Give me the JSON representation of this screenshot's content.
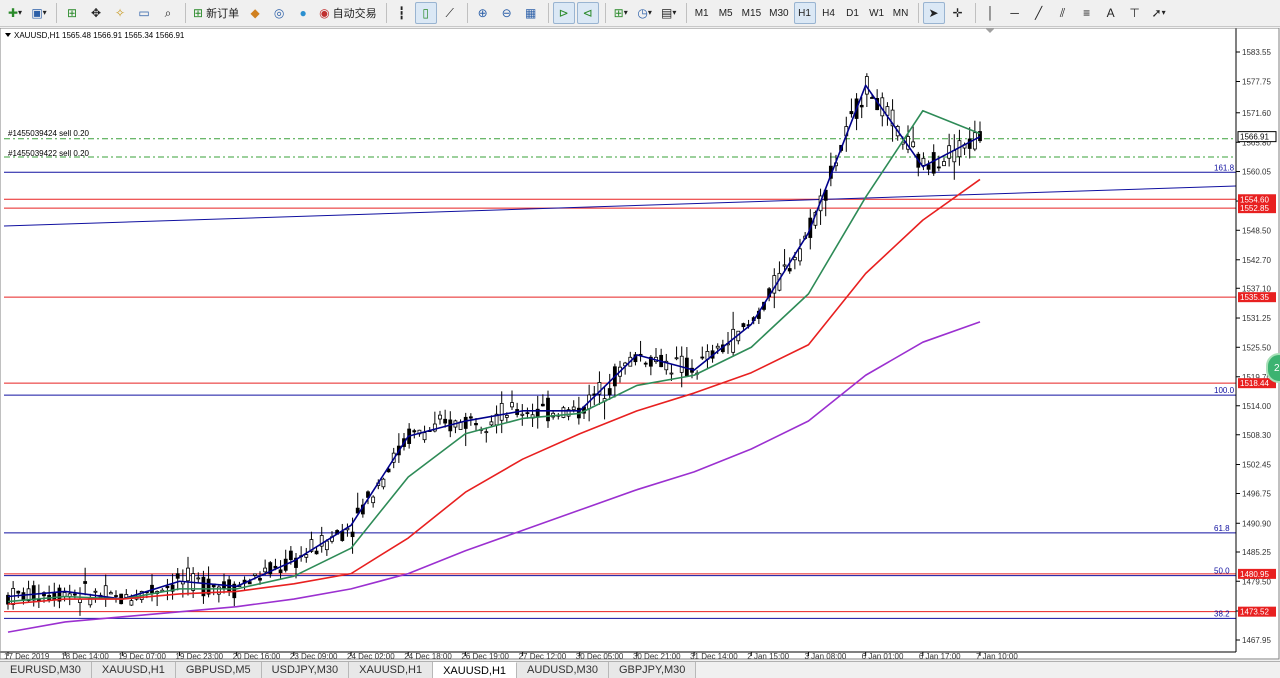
{
  "toolbar": {
    "new_order_label": "新订单",
    "auto_trade_label": "自动交易",
    "timeframes": [
      "M1",
      "M5",
      "M15",
      "M30",
      "H1",
      "H4",
      "D1",
      "W1",
      "MN"
    ],
    "active_timeframe": "H1",
    "text_tool_label": "A"
  },
  "chart": {
    "header": "XAUUSD,H1  1565.48 1566.91 1565.34 1566.91",
    "order_labels": [
      "#1455039424 sell 0.20",
      "#1455039422 sell 0.20"
    ],
    "current_price_tag": "1566.91",
    "price_ticks": [
      "1583.55",
      "1577.75",
      "1571.60",
      "1565.80",
      "1560.05",
      "1554.25",
      "1548.50",
      "1542.70",
      "1537.10",
      "1531.25",
      "1525.50",
      "1519.70",
      "1514.00",
      "1508.30",
      "1502.45",
      "1496.75",
      "1490.90",
      "1485.25",
      "1479.50",
      "1473.65",
      "1467.95"
    ],
    "price_tags": [
      {
        "label": "1554.60",
        "color": "#e82020"
      },
      {
        "label": "1552.85",
        "color": "#e82020"
      },
      {
        "label": "1535.35",
        "color": "#e82020"
      },
      {
        "label": "1518.44",
        "color": "#e82020"
      },
      {
        "label": "1480.95",
        "color": "#e82020"
      },
      {
        "label": "1473.52",
        "color": "#e82020"
      }
    ],
    "fib_labels": [
      "161.8",
      "100.0",
      "61.8",
      "50.0",
      "38.2"
    ],
    "time_labels": [
      "17 Dec 2019",
      "18 Dec 14:00",
      "19 Dec 07:00",
      "19 Dec 23:00",
      "20 Dec 16:00",
      "23 Dec 09:00",
      "24 Dec 02:00",
      "24 Dec 18:00",
      "26 Dec 19:00",
      "27 Dec 12:00",
      "30 Dec 05:00",
      "30 Dec 21:00",
      "31 Dec 14:00",
      "2 Jan 15:00",
      "3 Jan 08:00",
      "6 Jan 01:00",
      "6 Jan 17:00",
      "7 Jan 10:00"
    ],
    "bubble_text": "29"
  },
  "chart_data": {
    "type": "line",
    "symbol": "XAUUSD",
    "timeframe": "H1",
    "ylim": [
      1467.95,
      1583.55
    ],
    "ohlc_last": {
      "open": 1565.48,
      "high": 1566.91,
      "low": 1565.34,
      "close": 1566.91
    },
    "x": [
      "17 Dec 2019",
      "18 Dec 14:00",
      "19 Dec 07:00",
      "19 Dec 23:00",
      "20 Dec 16:00",
      "23 Dec 09:00",
      "24 Dec 02:00",
      "24 Dec 18:00",
      "26 Dec 19:00",
      "27 Dec 12:00",
      "30 Dec 05:00",
      "30 Dec 21:00",
      "31 Dec 14:00",
      "2 Jan 15:00",
      "3 Jan 08:00",
      "6 Jan 01:00",
      "6 Jan 17:00",
      "7 Jan 10:00"
    ],
    "series": [
      {
        "values": [
          1476.5,
          1477.5,
          1476.0,
          1479.5,
          1478.5,
          1483.5,
          1490.5,
          1508.0,
          1511.0,
          1513.0,
          1513.0,
          1524.0,
          1521.0,
          1530.0,
          1548.0,
          1577.0,
          1561.0,
          1566.9
        ],
        "color": "#00008b"
      },
      {
        "values": [
          1475.5,
          1476.5,
          1476.0,
          1478.0,
          1478.0,
          1480.5,
          1486.0,
          1500.0,
          1508.5,
          1511.5,
          1512.5,
          1518.0,
          1520.0,
          1525.5,
          1536.0,
          1555.0,
          1572.0,
          1567.5
        ],
        "color": "#2e8b57"
      },
      {
        "values": [
          1475.0,
          1476.0,
          1476.0,
          1477.0,
          1477.5,
          1479.0,
          1481.0,
          1488.0,
          1497.0,
          1503.5,
          1508.5,
          1513.0,
          1516.5,
          1520.5,
          1526.0,
          1540.0,
          1550.5,
          1558.5
        ],
        "color": "#e82020"
      },
      {
        "values": [
          1469.5,
          1471.5,
          1472.5,
          1473.5,
          1474.5,
          1476.0,
          1478.0,
          1481.0,
          1485.5,
          1489.5,
          1493.5,
          1497.5,
          1501.0,
          1505.5,
          1511.0,
          1520.0,
          1526.5,
          1530.5
        ],
        "color": "#9b30d0"
      }
    ],
    "horizontal_lines": [
      {
        "price": 1554.6,
        "color": "#e82020"
      },
      {
        "price": 1552.85,
        "color": "#e82020"
      },
      {
        "price": 1535.35,
        "color": "#e82020"
      },
      {
        "price": 1518.44,
        "color": "#e82020"
      },
      {
        "price": 1480.95,
        "color": "#e82020"
      },
      {
        "price": 1473.52,
        "color": "#e82020"
      },
      {
        "price": 1559.9,
        "color": "#1010a0"
      },
      {
        "price": 1516.1,
        "color": "#1010a0"
      },
      {
        "price": 1489.0,
        "color": "#1010a0"
      },
      {
        "price": 1480.6,
        "color": "#1010a0"
      },
      {
        "price": 1472.2,
        "color": "#1010a0"
      },
      {
        "price": 1566.5,
        "color": "#3aa03a"
      },
      {
        "price": 1562.9,
        "color": "#3aa03a"
      }
    ],
    "grid": false
  },
  "tabs": [
    "EURUSD,M30",
    "XAUUSD,H1",
    "GBPUSD,M5",
    "USDJPY,M30",
    "XAUUSD,H1",
    "XAUUSD,H1",
    "AUDUSD,M30",
    "GBPJPY,M30"
  ],
  "active_tab": 5
}
